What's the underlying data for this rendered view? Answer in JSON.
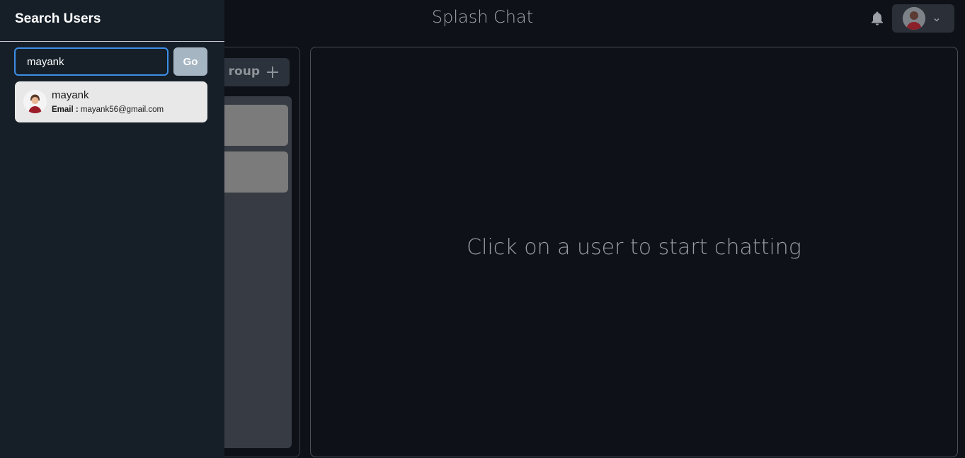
{
  "header": {
    "title": "Splash Chat",
    "bell_icon": "bell-icon",
    "chevron_icon": "chevron-down-icon"
  },
  "chats_panel": {
    "new_group_label": "roup",
    "plus_icon": "plus-icon"
  },
  "chat_box": {
    "placeholder": "Click on a user to start chatting"
  },
  "drawer": {
    "title": "Search Users",
    "search_value": "mayank",
    "go_label": "Go",
    "results": [
      {
        "name": "mayank",
        "email_label": "Email :",
        "email": "mayank56@gmail.com"
      }
    ]
  },
  "colors": {
    "background": "#0e1117",
    "drawer_bg": "#161f28",
    "input_focus": "#3d8ee6",
    "go_button": "#a6b5c2"
  }
}
